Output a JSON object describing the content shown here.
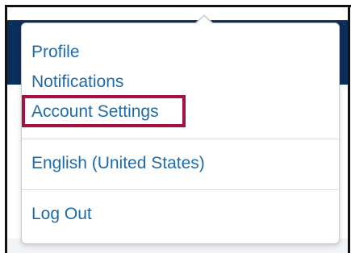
{
  "user_menu": {
    "items": [
      {
        "label": "Profile"
      },
      {
        "label": "Notifications"
      },
      {
        "label": "Account Settings",
        "highlighted": true
      }
    ],
    "language": {
      "label": "English (United States)"
    },
    "logout": {
      "label": "Log Out"
    }
  },
  "colors": {
    "navbar": "#0b2f5b",
    "link": "#1f6aa8",
    "highlight_border": "#a4123f",
    "divider": "#d8dbe0"
  }
}
